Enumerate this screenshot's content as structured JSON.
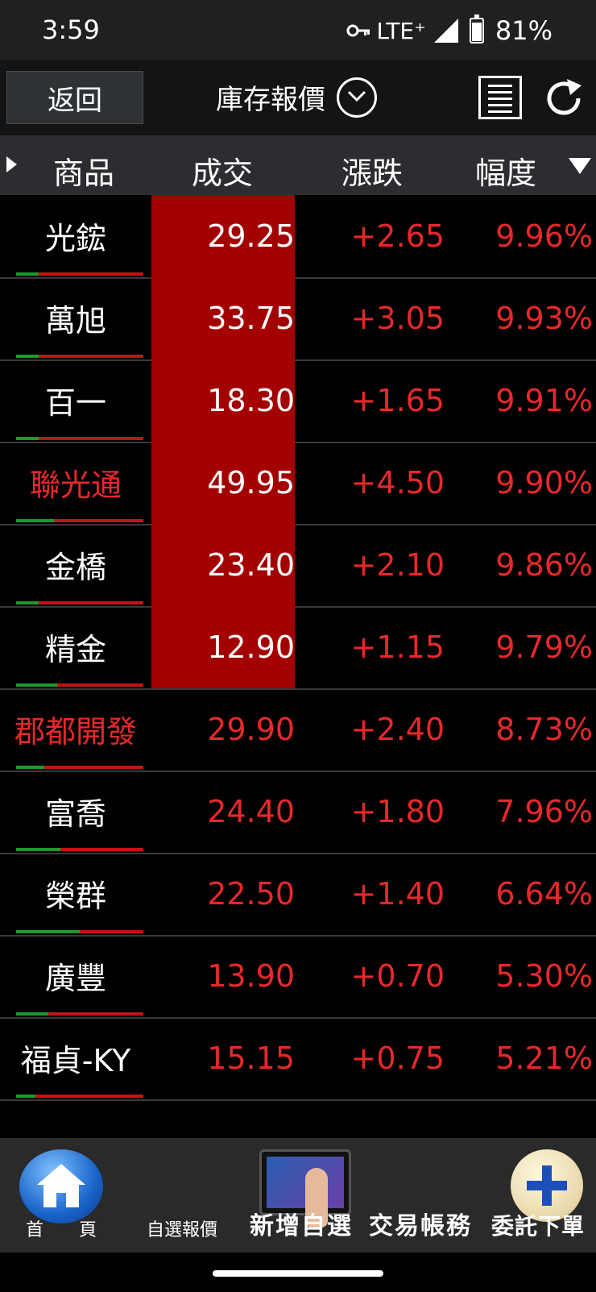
{
  "status_bar": {
    "time": "3:59",
    "network": "LTE⁺",
    "battery": "81%",
    "battery_level": 0.81
  },
  "header": {
    "back_label": "返回",
    "title": "庫存報價"
  },
  "columns": {
    "product": "商品",
    "price": "成交",
    "change": "漲跌",
    "percent": "幅度"
  },
  "rows": [
    {
      "name": "光鋐",
      "price": "29.25",
      "change": "+2.65",
      "percent": "9.96%",
      "name_red": false,
      "limit_up": true,
      "bar_green_fraction": 0.18
    },
    {
      "name": "萬旭",
      "price": "33.75",
      "change": "+3.05",
      "percent": "9.93%",
      "name_red": false,
      "limit_up": true,
      "bar_green_fraction": 0.18
    },
    {
      "name": "百一",
      "price": "18.30",
      "change": "+1.65",
      "percent": "9.91%",
      "name_red": false,
      "limit_up": true,
      "bar_green_fraction": 0.18
    },
    {
      "name": "聯光通",
      "price": "49.95",
      "change": "+4.50",
      "percent": "9.90%",
      "name_red": true,
      "limit_up": true,
      "bar_green_fraction": 0.3
    },
    {
      "name": "金橋",
      "price": "23.40",
      "change": "+2.10",
      "percent": "9.86%",
      "name_red": false,
      "limit_up": true,
      "bar_green_fraction": 0.18
    },
    {
      "name": "精金",
      "price": "12.90",
      "change": "+1.15",
      "percent": "9.79%",
      "name_red": false,
      "limit_up": true,
      "bar_green_fraction": 0.32
    },
    {
      "name": "郡都開發",
      "price": "29.90",
      "change": "+2.40",
      "percent": "8.73%",
      "name_red": true,
      "limit_up": false,
      "bar_green_fraction": 0.22
    },
    {
      "name": "富喬",
      "price": "24.40",
      "change": "+1.80",
      "percent": "7.96%",
      "name_red": false,
      "limit_up": false,
      "bar_green_fraction": 0.35
    },
    {
      "name": "榮群",
      "price": "22.50",
      "change": "+1.40",
      "percent": "6.64%",
      "name_red": false,
      "limit_up": false,
      "bar_green_fraction": 0.5
    },
    {
      "name": "廣豐",
      "price": "13.90",
      "change": "+0.70",
      "percent": "5.30%",
      "name_red": false,
      "limit_up": false,
      "bar_green_fraction": 0.25
    },
    {
      "name": "福貞-KY",
      "price": "15.15",
      "change": "+0.75",
      "percent": "5.21%",
      "name_red": false,
      "limit_up": false,
      "bar_green_fraction": 0.15
    }
  ],
  "bottom_nav": [
    {
      "label": "首　　頁",
      "icon": "home-icon"
    },
    {
      "label": "自選報價",
      "icon": "quote-icon"
    },
    {
      "label": "新增自選",
      "icon": "plus-icon"
    },
    {
      "label": "交易帳務",
      "icon": "account-icon"
    },
    {
      "label": "委託下單",
      "icon": "order-icon"
    }
  ]
}
